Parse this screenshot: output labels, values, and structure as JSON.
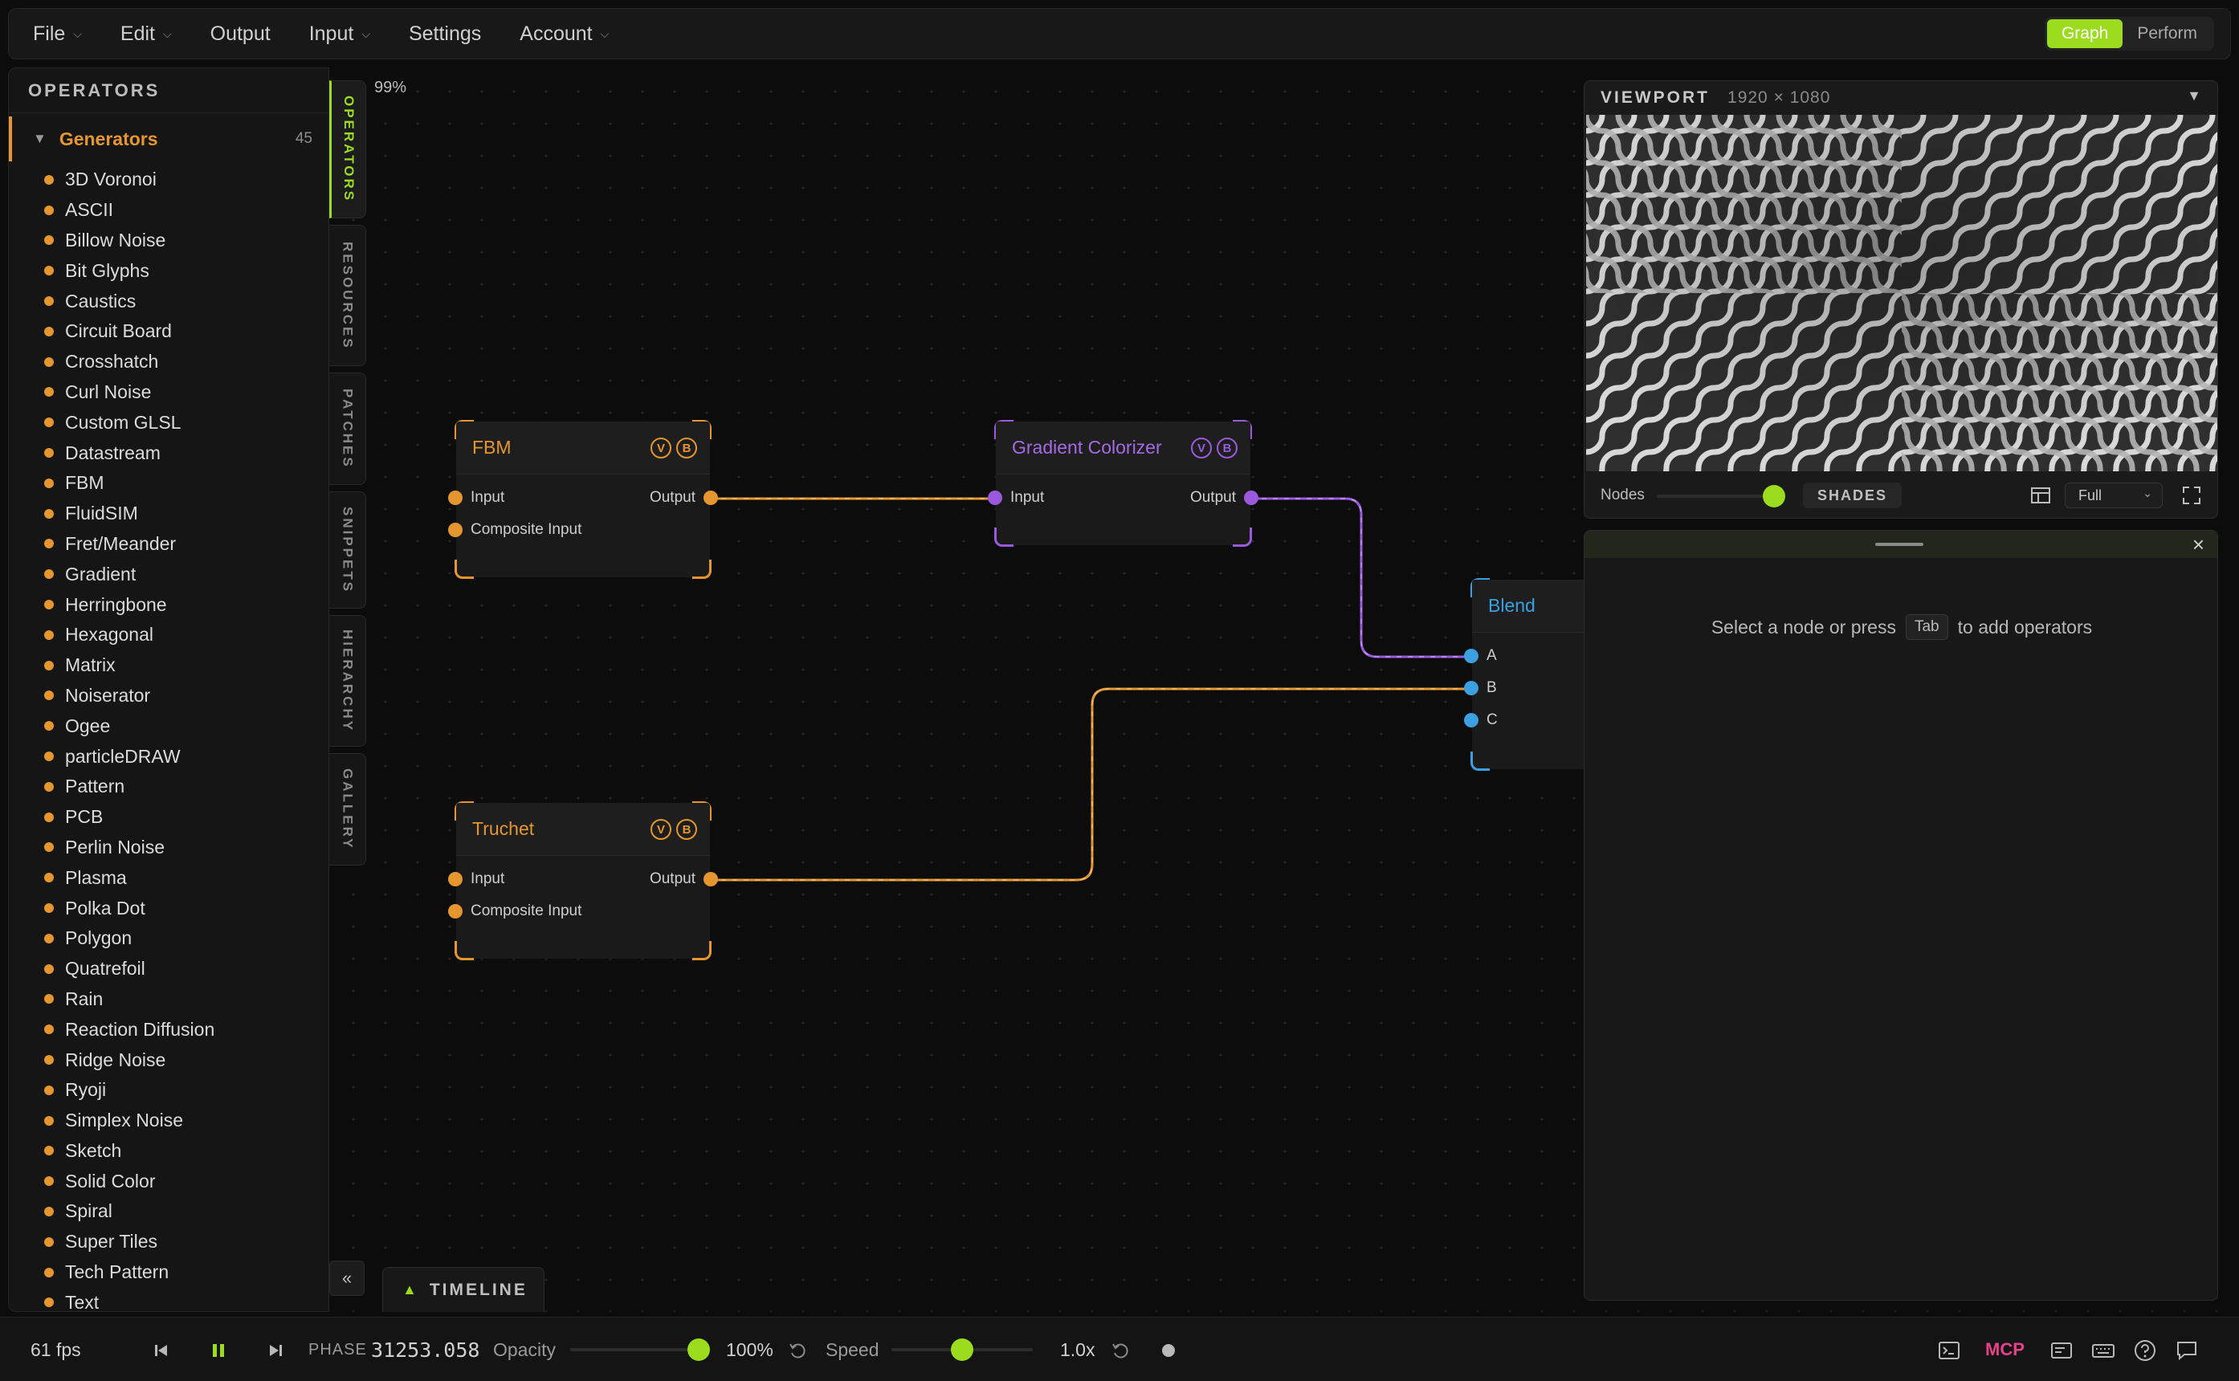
{
  "menubar": {
    "items": [
      {
        "label": "File",
        "has_menu": true
      },
      {
        "label": "Edit",
        "has_menu": true
      },
      {
        "label": "Output",
        "has_menu": false
      },
      {
        "label": "Input",
        "has_menu": true
      },
      {
        "label": "Settings",
        "has_menu": false
      },
      {
        "label": "Account",
        "has_menu": true
      }
    ],
    "modes": [
      {
        "label": "Graph",
        "active": true
      },
      {
        "label": "Perform",
        "active": false
      }
    ]
  },
  "operators": {
    "title": "OPERATORS",
    "category": {
      "label": "Generators",
      "count": "45"
    },
    "items": [
      "3D Voronoi",
      "ASCII",
      "Billow Noise",
      "Bit Glyphs",
      "Caustics",
      "Circuit Board",
      "Crosshatch",
      "Curl Noise",
      "Custom GLSL",
      "Datastream",
      "FBM",
      "FluidSIM",
      "Fret/Meander",
      "Gradient",
      "Herringbone",
      "Hexagonal",
      "Matrix",
      "Noiserator",
      "Ogee",
      "particleDRAW",
      "Pattern",
      "PCB",
      "Perlin Noise",
      "Plasma",
      "Polka Dot",
      "Polygon",
      "Quatrefoil",
      "Rain",
      "Reaction Diffusion",
      "Ridge Noise",
      "Ryoji",
      "Simplex Noise",
      "Sketch",
      "Solid Color",
      "Spiral",
      "Super Tiles",
      "Tech Pattern",
      "Text"
    ]
  },
  "side_tabs": [
    {
      "label": "OPERATORS",
      "active": true
    },
    {
      "label": "RESOURCES",
      "active": false
    },
    {
      "label": "PATCHES",
      "active": false
    },
    {
      "label": "SNIPPETS",
      "active": false
    },
    {
      "label": "HIERARCHY",
      "active": false
    },
    {
      "label": "GALLERY",
      "active": false
    }
  ],
  "canvas": {
    "zoom": "99%"
  },
  "nodes": {
    "fbm": {
      "title": "FBM",
      "badges": [
        "V",
        "B"
      ],
      "inputs": [
        "Input",
        "Composite Input"
      ],
      "output": "Output"
    },
    "gradient_colorizer": {
      "title": "Gradient Colorizer",
      "badges": [
        "V",
        "B"
      ],
      "inputs": [
        "Input"
      ],
      "output": "Output"
    },
    "truchet": {
      "title": "Truchet",
      "badges": [
        "V",
        "B"
      ],
      "inputs": [
        "Input",
        "Composite Input"
      ],
      "output": "Output"
    },
    "blend": {
      "title": "Blend",
      "inputs": [
        "A",
        "B",
        "C"
      ]
    }
  },
  "viewport": {
    "title": "VIEWPORT",
    "resolution": "1920 × 1080",
    "nodes_label": "Nodes",
    "shades_label": "SHADES",
    "size_option": "Full"
  },
  "inspector": {
    "hint_before": "Select a node or press",
    "hint_key": "Tab",
    "hint_after": "to add operators"
  },
  "timeline": {
    "label": "TIMELINE"
  },
  "statusbar": {
    "fps": "61 fps",
    "phase_label": "PHASE",
    "phase_value": "31253.058",
    "opacity_label": "Opacity",
    "opacity_value": "100%",
    "opacity_level": 1.0,
    "speed_label": "Speed",
    "speed_value": "1.0x",
    "mcp_label": "MCP"
  },
  "colors": {
    "accent_green": "#9bdc1e",
    "generator_orange": "#e5962f",
    "colorizer_purple": "#9b59dd",
    "blend_blue": "#3aa0e0",
    "mcp_pink": "#e8408c"
  },
  "icons": [
    "skip-back-icon",
    "pause-icon",
    "skip-forward-icon",
    "reset-icon",
    "terminal-icon",
    "panel-icon",
    "keyboard-icon",
    "help-icon",
    "chat-icon",
    "layout-icon",
    "fullscreen-icon",
    "close-icon",
    "collapse-icon"
  ]
}
